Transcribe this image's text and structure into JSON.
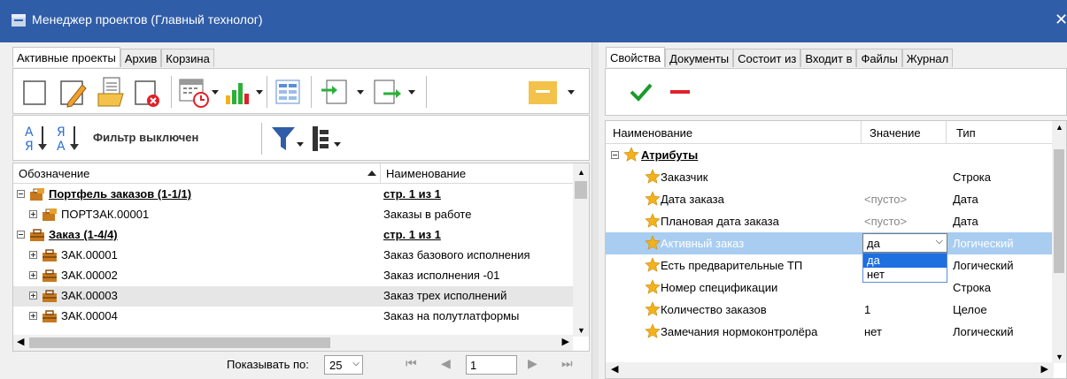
{
  "window": {
    "title": "Менеджер проектов (Главный технолог)",
    "close": "✕"
  },
  "left": {
    "tabs": [
      "Активные проекты",
      "Архив",
      "Корзина"
    ],
    "filter_label": "Фильтр выключен",
    "grid": {
      "columns": [
        "Обозначение",
        "Наименование"
      ],
      "rows": [
        {
          "designation": "Портфель заказов (1-1/1)",
          "name": "стр. 1 из 1",
          "kind": "group",
          "icon": "portfolio-icon"
        },
        {
          "designation": "ПОРТЗАК.00001",
          "name": "Заказы в работе",
          "kind": "item",
          "icon": "portfolio-icon"
        },
        {
          "designation": "Заказ (1-4/4)",
          "name": "стр. 1 из 1",
          "kind": "group",
          "icon": "order-icon"
        },
        {
          "designation": "ЗАК.00001",
          "name": "Заказ базового исполнения",
          "kind": "item",
          "icon": "order-icon"
        },
        {
          "designation": "ЗАК.00002",
          "name": "Заказ исполнения -01",
          "kind": "item",
          "icon": "order-icon"
        },
        {
          "designation": "ЗАК.00003",
          "name": "Заказ трех исполнений",
          "kind": "item",
          "icon": "order-icon",
          "selected": true
        },
        {
          "designation": "ЗАК.00004",
          "name": "Заказ на полутлатформы",
          "kind": "item",
          "icon": "order-icon"
        }
      ]
    },
    "pager": {
      "show_label": "Показывать по:",
      "page_size": "25",
      "page": "1"
    }
  },
  "right": {
    "tabs": [
      "Свойства",
      "Документы",
      "Состоит из",
      "Входит в",
      "Файлы",
      "Журнал"
    ],
    "grid": {
      "columns": [
        "Наименование",
        "Значение",
        "Тип"
      ],
      "group": "Атрибуты",
      "rows": [
        {
          "name": "Заказчик",
          "value": "",
          "type": "Строка"
        },
        {
          "name": "Дата заказа",
          "value": "<пусто>",
          "type": "Дата",
          "muted": true
        },
        {
          "name": "Плановая дата заказа",
          "value": "<пусто>",
          "type": "Дата",
          "muted": true
        },
        {
          "name": "Активный заказ",
          "value": "да",
          "type": "Логический",
          "selected": true
        },
        {
          "name": "Есть предварительные ТП",
          "value": "",
          "type": "Логический"
        },
        {
          "name": "Номер спецификации",
          "value": "",
          "type": "Строка"
        },
        {
          "name": "Количество заказов",
          "value": "1",
          "type": "Целое"
        },
        {
          "name": "Замечания нормоконтролёра",
          "value": "нет",
          "type": "Логический"
        }
      ],
      "dropdown_options": [
        "да",
        "нет"
      ]
    }
  },
  "colors": {
    "titlebar": "#2f5da8",
    "selection": "#a8cdf0",
    "accept": "#1a9a2a",
    "reject": "#e0202a",
    "star": "#f3b21b"
  }
}
